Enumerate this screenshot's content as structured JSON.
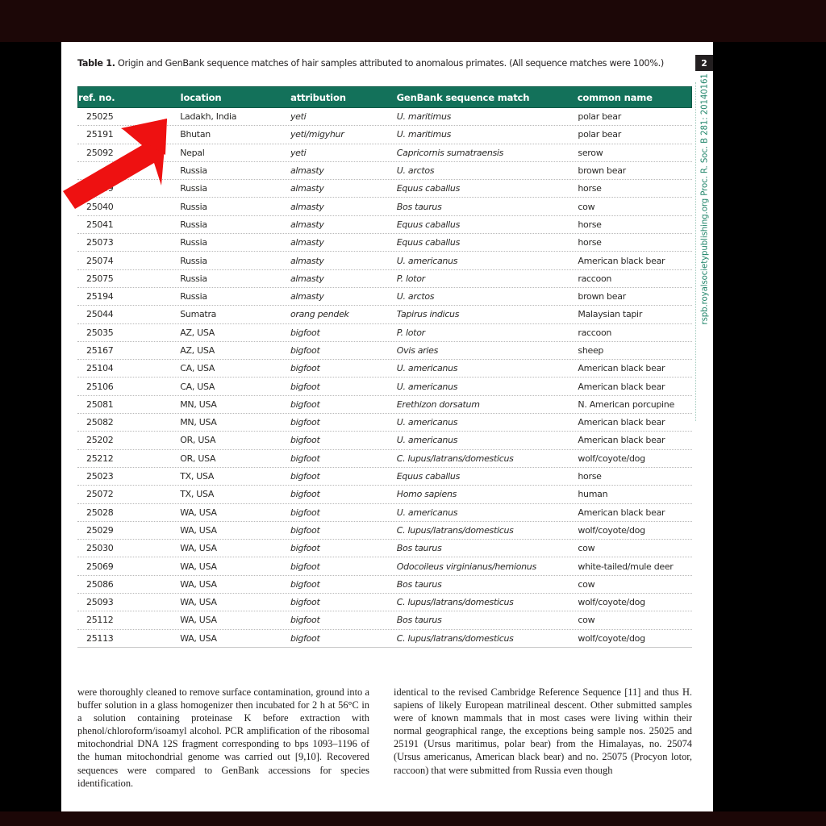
{
  "document": {
    "caption_prefix": "Table 1.",
    "caption_text": " Origin and GenBank sequence matches of hair samples attributed to anomalous primates. (All sequence matches were 100%.)",
    "page_number": "2",
    "margin_citation": "rspb.royalsocietypublishing.org    Proc. R. Soc. B 281: 20140161"
  },
  "table": {
    "columns": [
      "ref. no.",
      "location",
      "attribution",
      "GenBank sequence match",
      "common name"
    ],
    "rows": [
      [
        "25025",
        "Ladakh, India",
        "yeti",
        "U. maritimus",
        "polar bear"
      ],
      [
        "25191",
        "Bhutan",
        "yeti/migyhur",
        "U. maritimus",
        "polar bear"
      ],
      [
        "25092",
        "Nepal",
        "yeti",
        "Capricornis sumatraensis",
        "serow"
      ],
      [
        "",
        "Russia",
        "almasty",
        "U. arctos",
        "brown bear"
      ],
      [
        "25039",
        "Russia",
        "almasty",
        "Equus caballus",
        "horse"
      ],
      [
        "25040",
        "Russia",
        "almasty",
        "Bos taurus",
        "cow"
      ],
      [
        "25041",
        "Russia",
        "almasty",
        "Equus caballus",
        "horse"
      ],
      [
        "25073",
        "Russia",
        "almasty",
        "Equus caballus",
        "horse"
      ],
      [
        "25074",
        "Russia",
        "almasty",
        "U. americanus",
        "American black bear"
      ],
      [
        "25075",
        "Russia",
        "almasty",
        "P. lotor",
        "raccoon"
      ],
      [
        "25194",
        "Russia",
        "almasty",
        "U. arctos",
        "brown bear"
      ],
      [
        "25044",
        "Sumatra",
        "orang pendek",
        "Tapirus indicus",
        "Malaysian tapir"
      ],
      [
        "25035",
        "AZ, USA",
        "bigfoot",
        "P. lotor",
        "raccoon"
      ],
      [
        "25167",
        "AZ, USA",
        "bigfoot",
        "Ovis aries",
        "sheep"
      ],
      [
        "25104",
        "CA, USA",
        "bigfoot",
        "U. americanus",
        "American black bear"
      ],
      [
        "25106",
        "CA, USA",
        "bigfoot",
        "U. americanus",
        "American black bear"
      ],
      [
        "25081",
        "MN, USA",
        "bigfoot",
        "Erethizon dorsatum",
        "N. American porcupine"
      ],
      [
        "25082",
        "MN, USA",
        "bigfoot",
        "U. americanus",
        "American black bear"
      ],
      [
        "25202",
        "OR, USA",
        "bigfoot",
        "U. americanus",
        "American black bear"
      ],
      [
        "25212",
        "OR, USA",
        "bigfoot",
        "C. lupus/latrans/domesticus",
        "wolf/coyote/dog"
      ],
      [
        "25023",
        "TX, USA",
        "bigfoot",
        "Equus caballus",
        "horse"
      ],
      [
        "25072",
        "TX, USA",
        "bigfoot",
        "Homo sapiens",
        "human"
      ],
      [
        "25028",
        "WA, USA",
        "bigfoot",
        "U. americanus",
        "American black bear"
      ],
      [
        "25029",
        "WA, USA",
        "bigfoot",
        "C. lupus/latrans/domesticus",
        "wolf/coyote/dog"
      ],
      [
        "25030",
        "WA, USA",
        "bigfoot",
        "Bos taurus",
        "cow"
      ],
      [
        "25069",
        "WA, USA",
        "bigfoot",
        "Odocoileus virginianus/hemionus",
        "white-tailed/mule deer"
      ],
      [
        "25086",
        "WA, USA",
        "bigfoot",
        "Bos taurus",
        "cow"
      ],
      [
        "25093",
        "WA, USA",
        "bigfoot",
        "C. lupus/latrans/domesticus",
        "wolf/coyote/dog"
      ],
      [
        "25112",
        "WA, USA",
        "bigfoot",
        "Bos taurus",
        "cow"
      ],
      [
        "25113",
        "WA, USA",
        "bigfoot",
        "C. lupus/latrans/domesticus",
        "wolf/coyote/dog"
      ]
    ]
  },
  "body": {
    "left_column": "were thoroughly cleaned to remove surface contamination, ground into a buffer solution in a glass homogenizer then incubated for 2 h at 56°C in a solution containing proteinase K before extraction with phenol/chloroform/isoamyl alcohol. PCR amplification of the ribosomal mitochondrial DNA 12S fragment corresponding to bps 1093–1196 of the human mitochondrial genome was carried out [9,10]. Recovered sequences were compared to GenBank accessions for species identification.",
    "right_column": "identical to the revised Cambridge Reference Sequence [11] and thus H. sapiens of likely European matrilineal descent. Other submitted samples were of known mammals that in most cases were living within their normal geographical range, the exceptions being sample nos. 25025 and 25191 (Ursus maritimus, polar bear) from the Himalayas, no. 25074 (Ursus americanus, American black bear) and no. 25075 (Procyon lotor, raccoon) that were submitted from Russia even though"
  },
  "annotation": {
    "arrow_color": "#ee1111",
    "arrow_points_to": "Ladakh, India"
  },
  "colors": {
    "header_green": "#13715a",
    "margin_green": "#21856a",
    "band_maroon": "#1c0707"
  }
}
